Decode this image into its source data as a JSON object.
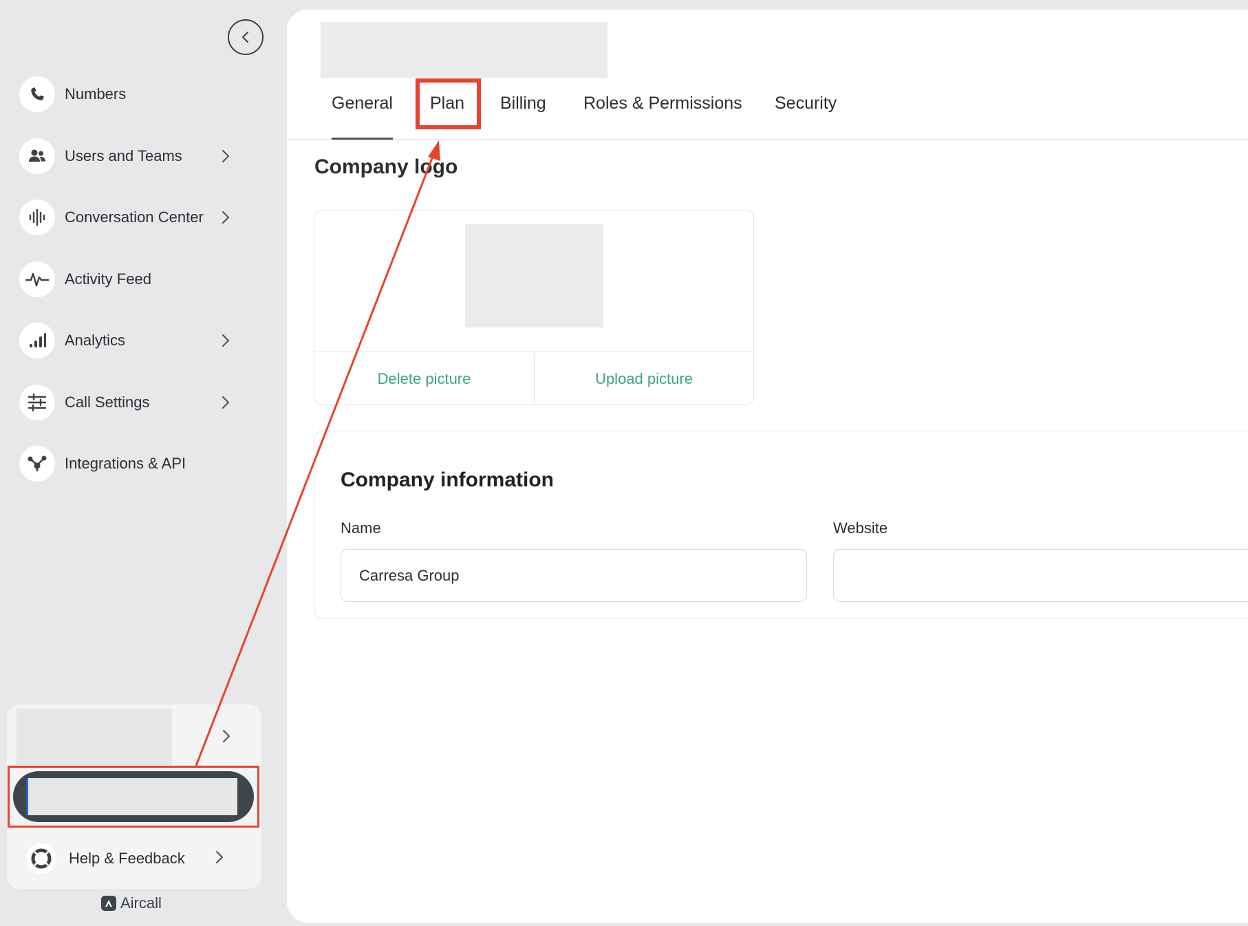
{
  "sidebar": {
    "items": [
      {
        "label": "Numbers",
        "icon": "phone-icon",
        "has_chevron": false
      },
      {
        "label": "Users and Teams",
        "icon": "users-icon",
        "has_chevron": true
      },
      {
        "label": "Conversation Center",
        "icon": "waveform-icon",
        "has_chevron": true
      },
      {
        "label": "Activity Feed",
        "icon": "pulse-icon",
        "has_chevron": false
      },
      {
        "label": "Analytics",
        "icon": "bar-chart-icon",
        "has_chevron": true
      },
      {
        "label": "Call Settings",
        "icon": "sliders-icon",
        "has_chevron": true
      },
      {
        "label": "Integrations & API",
        "icon": "integrations-icon",
        "has_chevron": false
      }
    ],
    "help_label": "Help & Feedback",
    "brand": "Aircall"
  },
  "main": {
    "tabs": [
      {
        "label": "General",
        "active": true
      },
      {
        "label": "Plan",
        "active": false
      },
      {
        "label": "Billing",
        "active": false
      },
      {
        "label": "Roles & Permissions",
        "active": false
      },
      {
        "label": "Security",
        "active": false
      }
    ],
    "company_logo": {
      "title": "Company logo",
      "delete_label": "Delete picture",
      "upload_label": "Upload picture"
    },
    "company_info": {
      "title": "Company information",
      "name_label": "Name",
      "name_value": "Carresa Group",
      "website_label": "Website",
      "website_value": ""
    }
  },
  "colors": {
    "accent_green": "#3aa67a",
    "annotation_red": "#e8432f",
    "sidebar_bg": "#e8e8ea",
    "dark_pill": "#3d464d"
  }
}
